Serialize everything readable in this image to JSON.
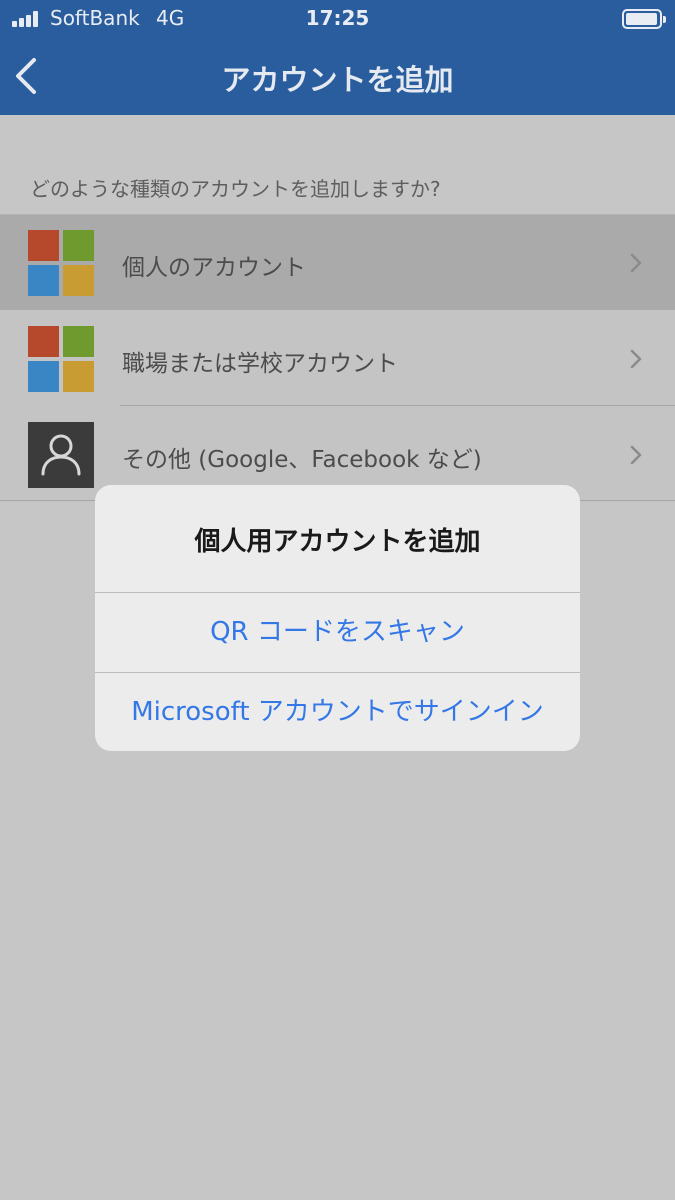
{
  "status": {
    "carrier": "SoftBank",
    "network": "4G",
    "time": "17:25"
  },
  "nav": {
    "title": "アカウントを追加",
    "back_icon": "chevron-left-icon"
  },
  "prompt": "どのような種類のアカウントを追加しますか?",
  "accounts": [
    {
      "label": "個人のアカウント",
      "icon": "microsoft-logo-icon"
    },
    {
      "label": "職場または学校アカウント",
      "icon": "microsoft-logo-icon"
    },
    {
      "label": "その他 (Google、Facebook など)",
      "icon": "person-icon"
    }
  ],
  "sheet": {
    "title": "個人用アカウントを追加",
    "actions": [
      {
        "label": "QR コードをスキャン"
      },
      {
        "label": "Microsoft アカウントでサインイン"
      }
    ]
  },
  "colors": {
    "header": "#2a5d9e",
    "action_text": "#3477e6",
    "ms_red": "#b6492c",
    "ms_green": "#6e9a2e",
    "ms_blue": "#3a86c4",
    "ms_yellow": "#c99c33"
  }
}
